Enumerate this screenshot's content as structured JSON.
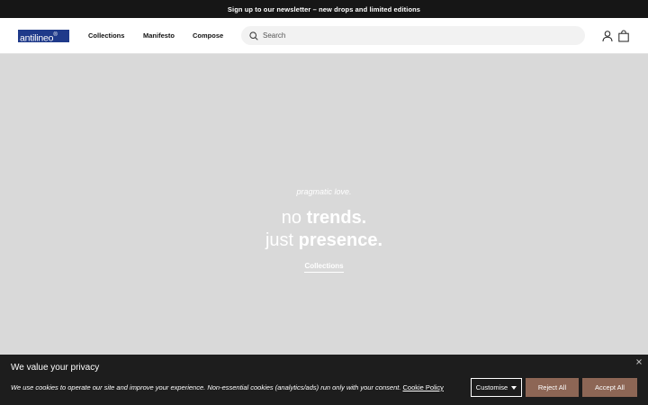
{
  "announcement": {
    "text": "Sign up to our newsletter – new drops and limited editions"
  },
  "header": {
    "logo": "antilineo",
    "logo_mark": "®",
    "nav": {
      "collections": "Collections",
      "manifesto": "Manifesto",
      "compose": "Compose"
    },
    "search": {
      "placeholder": "Search",
      "icon": "search-icon"
    },
    "icons": [
      "account-icon",
      "shopping-bag-icon"
    ]
  },
  "hero": {
    "tagline": "pragmatic love.",
    "title_line1_prefix": "no ",
    "title_line1_bold": "trends.",
    "title_line2_prefix": "just ",
    "title_line2_bold": "presence.",
    "cta": "Collections",
    "background_color": "#d9d9d9"
  },
  "cookie_banner": {
    "title": "We value your privacy",
    "text": "We use cookies to operate our site and improve your experience. Non-essential cookies (analytics/ads) run only with your consent. ",
    "policy_link": "Cookie Policy",
    "buttons": {
      "customise": "Customise",
      "reject": "Reject All",
      "accept": "Accept All"
    },
    "accent_color": "#8d6655"
  }
}
